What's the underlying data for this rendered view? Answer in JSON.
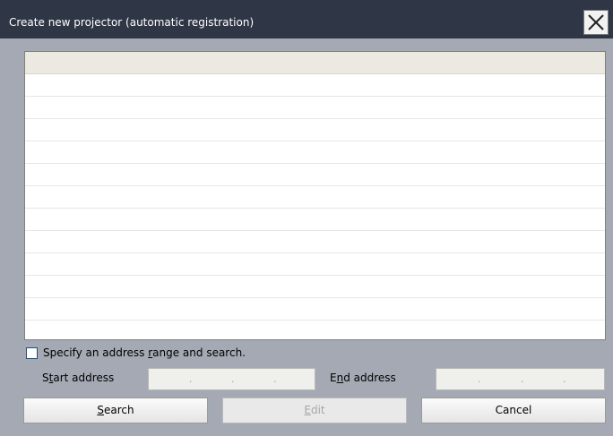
{
  "window": {
    "title": "Create new projector (automatic registration)"
  },
  "list": {
    "rows": 11
  },
  "range": {
    "checkbox_label_pre": "Specify an address ",
    "checkbox_label_key": "r",
    "checkbox_label_post": "ange and search.",
    "checked": false,
    "start_label_pre": "S",
    "start_label_key": "t",
    "start_label_post": "art address",
    "end_label_pre": "E",
    "end_label_key": "n",
    "end_label_post": "d address",
    "ip_separator": "."
  },
  "buttons": {
    "search_key": "S",
    "search_rest": "earch",
    "edit_key": "E",
    "edit_rest": "dit",
    "cancel_label": "Cancel"
  },
  "icons": {
    "close": "close-icon"
  }
}
